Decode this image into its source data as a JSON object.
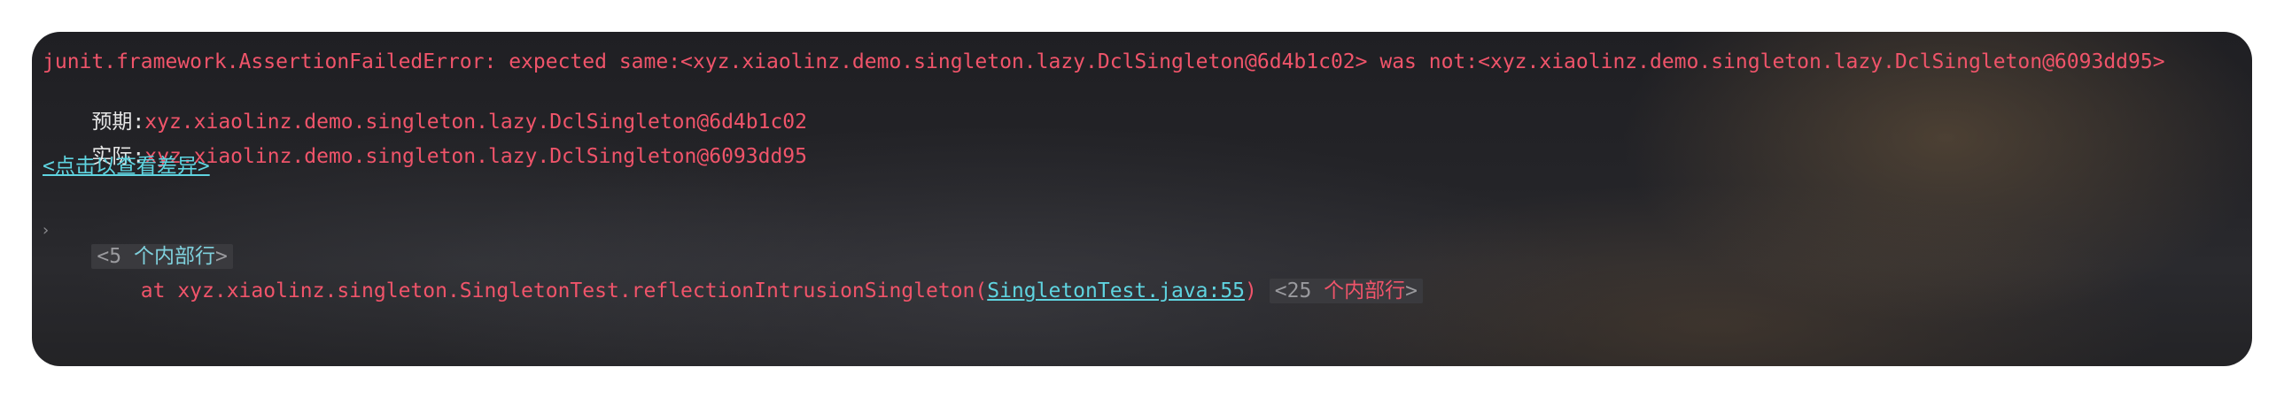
{
  "console": {
    "error_line": "junit.framework.AssertionFailedError: expected same:<xyz.xiaolinz.demo.singleton.lazy.DclSingleton@6d4b1c02> was not:<xyz.xiaolinz.demo.singleton.lazy.DclSingleton@6093dd95>",
    "expected_label": "预期:",
    "expected_value": "xyz.xiaolinz.demo.singleton.lazy.DclSingleton@6d4b1c02",
    "actual_label": "实际:",
    "actual_value": "xyz.xiaolinz.demo.singleton.lazy.DclSingleton@6093dd95",
    "diff_link": "<点击以查看差异>",
    "fold1_open": "<5 ",
    "fold1_text": "个内部行",
    "fold1_close": ">",
    "stack_prefix": "    at xyz.xiaolinz.singleton.SingletonTest.reflectionIntrusionSingleton(",
    "stack_link": "SingletonTest.java:55",
    "stack_suffix": ")",
    "fold2_open": "<25 ",
    "fold2_text": "个内部行",
    "fold2_close": ">"
  },
  "colors": {
    "error": "#f0546a",
    "link": "#5fd4e0",
    "fold_bg": "#3a3a3e"
  }
}
